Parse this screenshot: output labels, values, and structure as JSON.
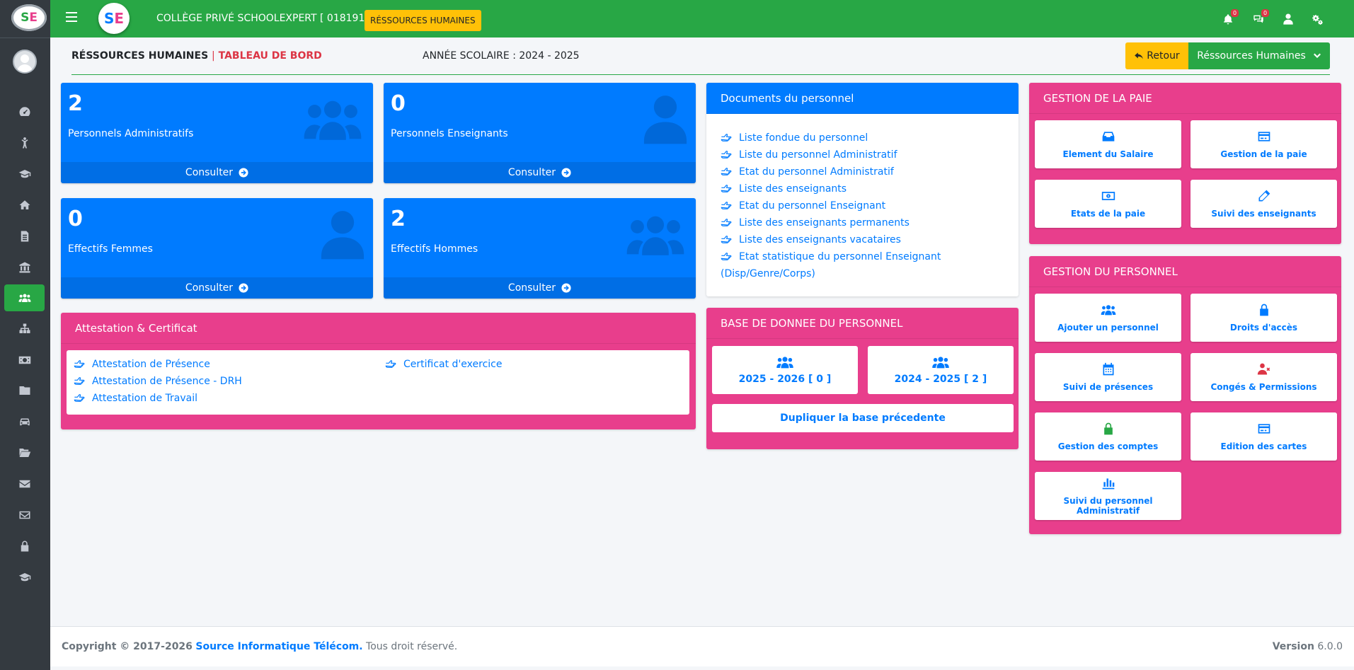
{
  "sidebar": {
    "logo_a": "S",
    "logo_b": "E",
    "items": [
      {
        "icon": "tachometer-icon"
      },
      {
        "icon": "child-icon"
      },
      {
        "icon": "graduation-cap-icon"
      },
      {
        "icon": "home-icon"
      },
      {
        "icon": "file-icon"
      },
      {
        "icon": "institution-icon"
      },
      {
        "icon": "users-icon",
        "active": true
      },
      {
        "icon": "sitemap-icon"
      },
      {
        "icon": "money-icon"
      },
      {
        "icon": "folder-icon"
      },
      {
        "icon": "car-icon"
      },
      {
        "icon": "folder-open-icon"
      },
      {
        "icon": "envelope-icon"
      },
      {
        "icon": "envelope-outline-icon"
      },
      {
        "icon": "lock-icon"
      },
      {
        "icon": "mortar-board-icon"
      }
    ]
  },
  "topbar": {
    "logo_a": "S",
    "logo_b": "E",
    "school_name": "COLLÈGE PRIVÉ SCHOOLEXPERT [ 018191 ] |",
    "module_badge": "RÉSSOURCES HUMAINES",
    "notifications_count": "0",
    "messages_count": "0"
  },
  "header": {
    "title_main": "RÉSSOURCES HUMAINES",
    "title_sep": "|",
    "title_sub": "TABLEAU DE BORD",
    "school_year": "ANNÉE SCOLAIRE : 2024 - 2025",
    "back_label": "Retour",
    "module_menu_label": "Réssources Humaines"
  },
  "stats": [
    {
      "value": "2",
      "label": "Personnels Administratifs",
      "link": "Consulter"
    },
    {
      "value": "0",
      "label": "Personnels Enseignants",
      "link": "Consulter"
    },
    {
      "value": "0",
      "label": "Effectifs Femmes",
      "link": "Consulter"
    },
    {
      "value": "2",
      "label": "Effectifs Hommes",
      "link": "Consulter"
    }
  ],
  "attestation": {
    "title": "Attestation & Certificat",
    "col1": [
      "Attestation de Présence",
      "Attestation de Présence - DRH",
      "Attestation de Travail"
    ],
    "col2": [
      "Certificat d'exercice"
    ]
  },
  "documents": {
    "title": "Documents du personnel",
    "links": [
      "Liste fondue du personnel",
      "Liste du personnel Administratif",
      "Etat du personnel Administratif",
      "Liste des enseignants",
      "Etat du personnel Enseignant",
      "Liste des enseignants permanents",
      "Liste des enseignants vacataires",
      "Etat statistique du personnel Enseignant"
    ],
    "last_link_cont": "(Disp/Genre/Corps)"
  },
  "base": {
    "title": "BASE DE DONNEE DU PERSONNEL",
    "year1": "2025 - 2026 [ 0 ]",
    "year2": "2024 - 2025 [ 2 ]",
    "duplicate": "Dupliquer la base précedente"
  },
  "paie": {
    "title": "GESTION DE LA PAIE",
    "tiles": [
      "Element du Salaire",
      "Gestion de la paie",
      "Etats de la paie",
      "Suivi des enseignants"
    ]
  },
  "personnel": {
    "title": "GESTION DU PERSONNEL",
    "tiles": [
      "Ajouter un personnel",
      "Droits d'accès",
      "Suivi de présences",
      "Congés & Permissions",
      "Gestion des comptes",
      "Edition des cartes",
      "Suivi du personnel Administratif"
    ]
  },
  "footer": {
    "copyright": "Copyright © 2017-2026",
    "company": "Source Informatique Télécom.",
    "rights": "Tous droit réservé.",
    "version_label": "Version",
    "version": "6.0.0"
  },
  "colors": {
    "green": "#28a745",
    "blue": "#007bff",
    "pink": "#e83e8c",
    "yellow": "#ffc107",
    "sidebar": "#343a40"
  }
}
